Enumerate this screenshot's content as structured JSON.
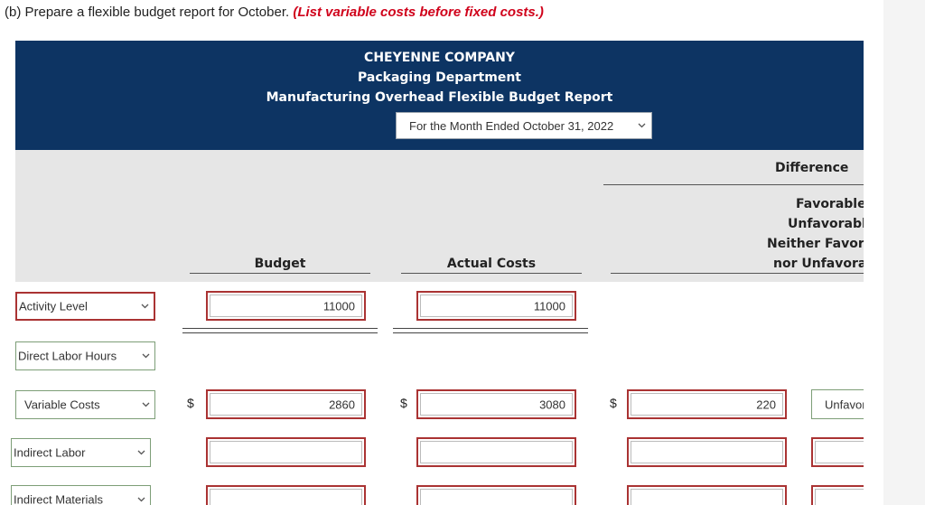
{
  "instruction": {
    "part": "(b) Prepare a flexible budget report for October.",
    "note": "(List variable costs before fixed costs.)"
  },
  "report": {
    "company": "CHEYENNE COMPANY",
    "department": "Packaging Department",
    "title": "Manufacturing Overhead Flexible Budget Report",
    "period": "For the Month Ended October 31, 2022"
  },
  "columns": {
    "budget": "Budget",
    "actual": "Actual Costs",
    "difference": "Difference",
    "difference_options": [
      "Favorable",
      "Unfavorable",
      "Neither Favorable",
      "nor Unfavorable"
    ]
  },
  "rows": {
    "activity_level": {
      "label": "Activity Level",
      "budget": "11000",
      "actual": "11000"
    },
    "direct_labor_hours": {
      "label": "Direct Labor Hours"
    },
    "variable_costs": {
      "label": "Variable Costs",
      "currency": "$",
      "budget": "2860",
      "actual": "3080",
      "difference": "220",
      "status": "Unfavorable"
    },
    "indirect_labor": {
      "label": "Indirect Labor",
      "budget": "",
      "actual": "",
      "difference": "",
      "status": ""
    },
    "indirect_materials": {
      "label": "Indirect Materials",
      "budget": "",
      "actual": "",
      "difference": "",
      "status": ""
    }
  }
}
